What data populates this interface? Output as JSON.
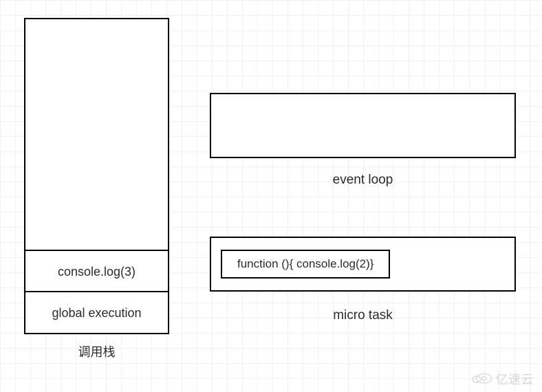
{
  "call_stack": {
    "label": "调用栈",
    "frames": [
      {
        "content": "console.log(3)"
      },
      {
        "content": "global execution"
      }
    ]
  },
  "event_loop": {
    "label": "event loop"
  },
  "micro_task": {
    "label": "micro task",
    "items": [
      {
        "content": "function (){ console.log(2)}"
      }
    ]
  },
  "watermark": {
    "text": "亿速云"
  }
}
